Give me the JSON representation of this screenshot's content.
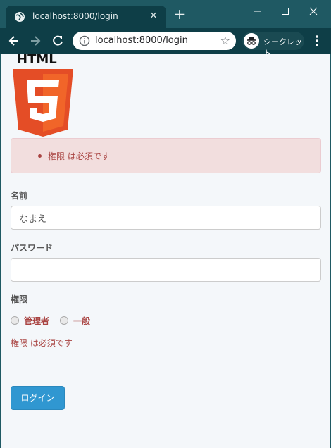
{
  "browser": {
    "tab_title": "localhost:8000/login",
    "tab_close": "×",
    "new_tab": "+",
    "url": "localhost:8000/login",
    "star": "☆",
    "incognito_label": "シークレット"
  },
  "logo": {
    "text": "HTML",
    "shield_number": "5",
    "colors": {
      "shield": "#e44d26",
      "shield_light": "#f16529"
    }
  },
  "alert": {
    "errors": [
      "権限 は必須です"
    ]
  },
  "form": {
    "name_label": "名前",
    "name_value": "なまえ",
    "password_label": "パスワード",
    "password_value": "",
    "role_label": "権限",
    "role_options": [
      "管理者",
      "一般"
    ],
    "role_error": "権限 は必須です",
    "submit_label": "ログイン"
  },
  "colors": {
    "error": "#a94442",
    "alert_bg": "#f2dede",
    "primary": "#3097d1",
    "chrome": "#1f5963"
  }
}
